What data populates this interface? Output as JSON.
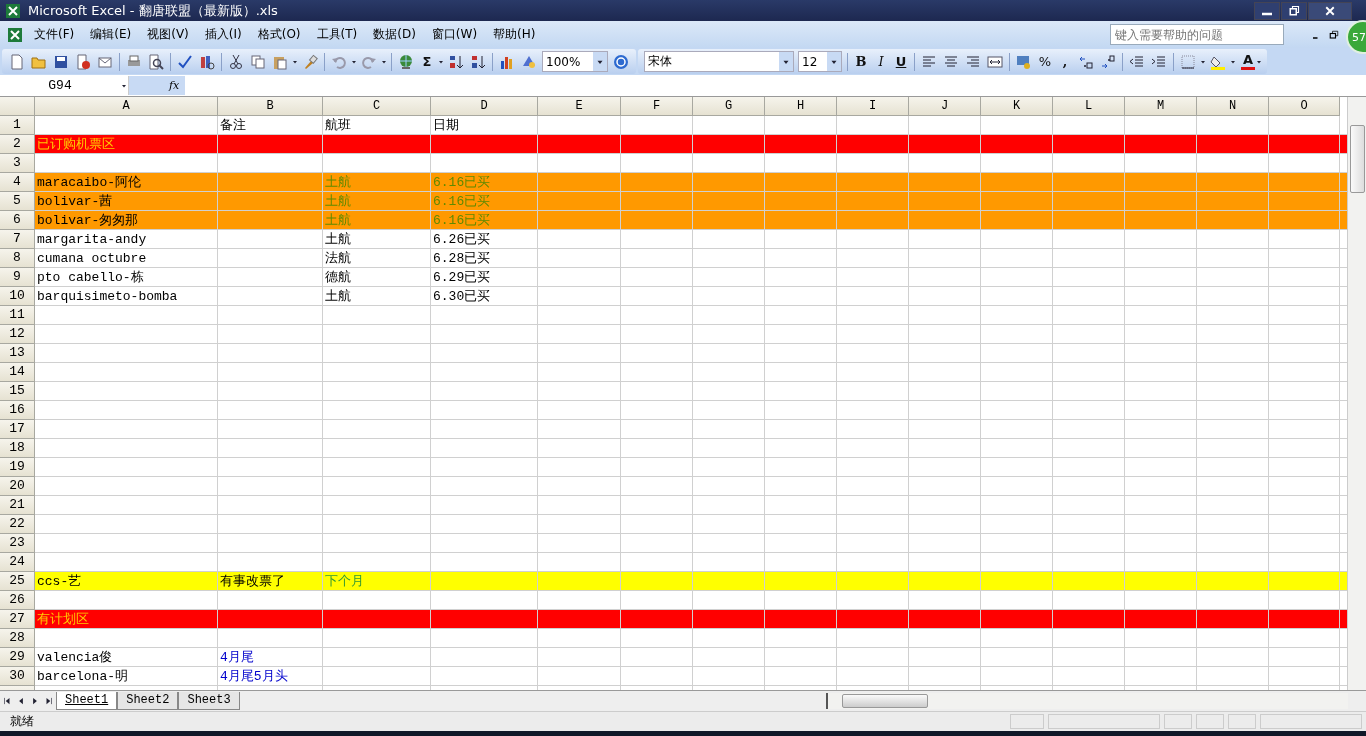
{
  "window": {
    "title": "Microsoft Excel - 翻唐联盟（最新版）.xls",
    "badge": "57"
  },
  "menu": [
    {
      "label": "文件(F)"
    },
    {
      "label": "编辑(E)"
    },
    {
      "label": "视图(V)"
    },
    {
      "label": "插入(I)"
    },
    {
      "label": "格式(O)"
    },
    {
      "label": "工具(T)"
    },
    {
      "label": "数据(D)"
    },
    {
      "label": "窗口(W)"
    },
    {
      "label": "帮助(H)"
    }
  ],
  "help_box": {
    "placeholder": "键入需要帮助的问题"
  },
  "toolbar": {
    "sum": "Σ",
    "zoom": "100%",
    "font": "宋体",
    "size": "12",
    "bold": "B",
    "italic": "I",
    "underline": "U",
    "percent": "%",
    "comma": ",",
    "font_color": "A"
  },
  "formula_bar": {
    "name_box": "G94",
    "fx": "fx"
  },
  "columns": [
    "A",
    "B",
    "C",
    "D",
    "E",
    "F",
    "G",
    "H",
    "I",
    "J",
    "K",
    "L",
    "M",
    "N",
    "O"
  ],
  "rows": [
    {
      "number": "1",
      "B": {
        "text": "备注",
        "kind": "plain"
      },
      "C": {
        "text": "航班",
        "kind": "plain"
      },
      "D": {
        "text": "日期",
        "kind": "plain"
      }
    },
    {
      "number": "2",
      "color": "#ff0000",
      "A": {
        "text": "已订购机票区",
        "kind": "section"
      }
    },
    {
      "number": "3"
    },
    {
      "number": "4",
      "color": "#ff9900",
      "A": {
        "text": "maracaibo-阿伦",
        "kind": "plain"
      },
      "C": {
        "text": "土航",
        "kind": "booked"
      },
      "D": {
        "text": "6.16已买",
        "kind": "booked"
      }
    },
    {
      "number": "5",
      "color": "#ff9900",
      "A": {
        "text": "bolivar-茜",
        "kind": "plain"
      },
      "C": {
        "text": "土航",
        "kind": "booked"
      },
      "D": {
        "text": "6.16已买",
        "kind": "booked"
      }
    },
    {
      "number": "6",
      "color": "#ff9900",
      "A": {
        "text": "bolivar-匆匆那",
        "kind": "plain"
      },
      "C": {
        "text": "土航",
        "kind": "booked"
      },
      "D": {
        "text": "6.16已买",
        "kind": "booked"
      }
    },
    {
      "number": "7",
      "A": {
        "text": "margarita-andy",
        "kind": "plain"
      },
      "C": {
        "text": "土航",
        "kind": "plain"
      },
      "D": {
        "text": "6.26已买",
        "kind": "plain"
      }
    },
    {
      "number": "8",
      "A": {
        "text": "cumana octubre",
        "kind": "plain"
      },
      "C": {
        "text": "法航",
        "kind": "plain"
      },
      "D": {
        "text": "6.28已买",
        "kind": "plain"
      }
    },
    {
      "number": "9",
      "A": {
        "text": "pto cabello-栋",
        "kind": "plain"
      },
      "C": {
        "text": "德航",
        "kind": "plain"
      },
      "D": {
        "text": "6.29已买",
        "kind": "plain"
      }
    },
    {
      "number": "10",
      "A": {
        "text": "barquisimeto-bomba",
        "kind": "plain"
      },
      "C": {
        "text": "土航",
        "kind": "plain"
      },
      "D": {
        "text": "6.30已买",
        "kind": "plain"
      }
    },
    {
      "number": "11"
    },
    {
      "number": "12"
    },
    {
      "number": "13"
    },
    {
      "number": "14"
    },
    {
      "number": "15"
    },
    {
      "number": "16"
    },
    {
      "number": "17"
    },
    {
      "number": "18"
    },
    {
      "number": "19"
    },
    {
      "number": "20"
    },
    {
      "number": "21"
    },
    {
      "number": "22"
    },
    {
      "number": "23"
    },
    {
      "number": "24"
    },
    {
      "number": "25",
      "color": "#ffff00",
      "A": {
        "text": "ccs-艺",
        "kind": "plain"
      },
      "B": {
        "text": "有事改票了",
        "kind": "plain"
      },
      "C": {
        "text": "下个月",
        "kind": "deferred"
      }
    },
    {
      "number": "26"
    },
    {
      "number": "27",
      "color": "#ff0000",
      "A": {
        "text": "有计划区",
        "kind": "section"
      }
    },
    {
      "number": "28"
    },
    {
      "number": "29",
      "A": {
        "text": "valencia俊",
        "kind": "plain"
      },
      "B": {
        "text": "4月尾",
        "kind": "planned"
      }
    },
    {
      "number": "30",
      "A": {
        "text": "barcelona-明",
        "kind": "plain"
      },
      "B": {
        "text": "4月尾5月头",
        "kind": "planned"
      }
    }
  ],
  "sheet_tabs": [
    {
      "label": "Sheet1",
      "selected": true
    },
    {
      "label": "Sheet2",
      "selected": false
    },
    {
      "label": "Sheet3",
      "selected": false
    }
  ],
  "status_bar": {
    "text": "就绪"
  }
}
